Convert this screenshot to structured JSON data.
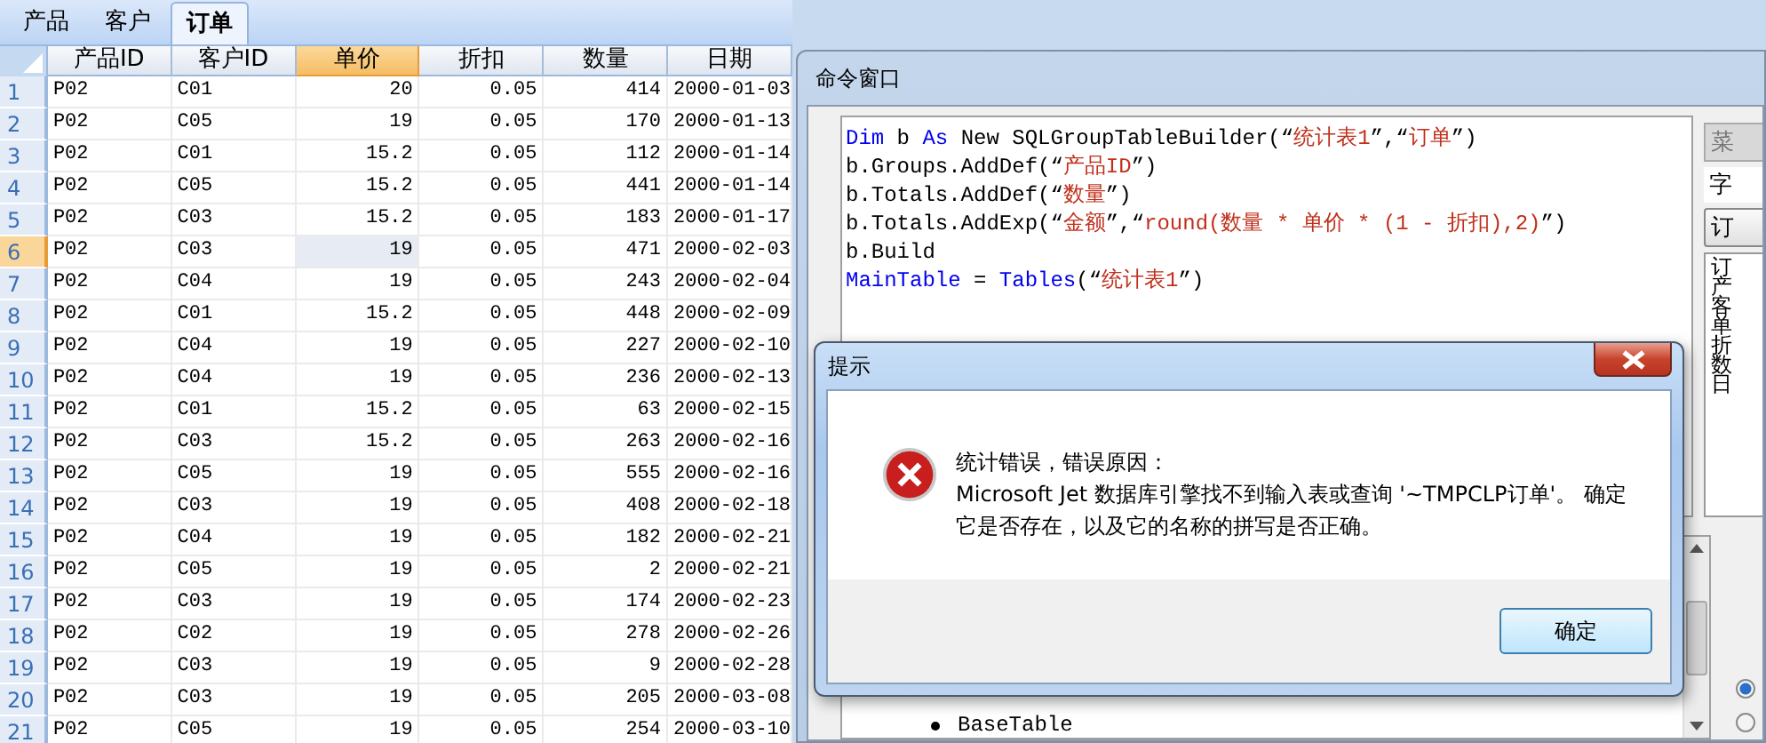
{
  "tabs": [
    {
      "label": "产品",
      "selected": false
    },
    {
      "label": "客户",
      "selected": false
    },
    {
      "label": "订单",
      "selected": true
    }
  ],
  "table": {
    "columns": [
      {
        "label": "产品ID",
        "kind": "text",
        "selected": false
      },
      {
        "label": "客户ID",
        "kind": "text",
        "selected": false
      },
      {
        "label": "单价",
        "kind": "number",
        "selected": true
      },
      {
        "label": "折扣",
        "kind": "number",
        "selected": false
      },
      {
        "label": "数量",
        "kind": "number",
        "selected": false
      },
      {
        "label": "日期",
        "kind": "text",
        "selected": false
      }
    ],
    "rows": [
      {
        "number": "1",
        "selected": false,
        "cells": [
          "P02",
          "C01",
          "20",
          "0.05",
          "414",
          "2000-01-03"
        ]
      },
      {
        "number": "2",
        "selected": false,
        "cells": [
          "P02",
          "C05",
          "19",
          "0.05",
          "170",
          "2000-01-13"
        ]
      },
      {
        "number": "3",
        "selected": false,
        "cells": [
          "P02",
          "C01",
          "15.2",
          "0.05",
          "112",
          "2000-01-14"
        ]
      },
      {
        "number": "4",
        "selected": false,
        "cells": [
          "P02",
          "C05",
          "15.2",
          "0.05",
          "441",
          "2000-01-14"
        ]
      },
      {
        "number": "5",
        "selected": false,
        "cells": [
          "P02",
          "C03",
          "15.2",
          "0.05",
          "183",
          "2000-01-17"
        ]
      },
      {
        "number": "6",
        "selected": true,
        "cells": [
          "P02",
          "C03",
          "19",
          "0.05",
          "471",
          "2000-02-03"
        ]
      },
      {
        "number": "7",
        "selected": false,
        "cells": [
          "P02",
          "C04",
          "19",
          "0.05",
          "243",
          "2000-02-04"
        ]
      },
      {
        "number": "8",
        "selected": false,
        "cells": [
          "P02",
          "C01",
          "15.2",
          "0.05",
          "448",
          "2000-02-09"
        ]
      },
      {
        "number": "9",
        "selected": false,
        "cells": [
          "P02",
          "C04",
          "19",
          "0.05",
          "227",
          "2000-02-10"
        ]
      },
      {
        "number": "10",
        "selected": false,
        "cells": [
          "P02",
          "C04",
          "19",
          "0.05",
          "236",
          "2000-02-13"
        ]
      },
      {
        "number": "11",
        "selected": false,
        "cells": [
          "P02",
          "C01",
          "15.2",
          "0.05",
          "63",
          "2000-02-15"
        ]
      },
      {
        "number": "12",
        "selected": false,
        "cells": [
          "P02",
          "C03",
          "15.2",
          "0.05",
          "263",
          "2000-02-16"
        ]
      },
      {
        "number": "13",
        "selected": false,
        "cells": [
          "P02",
          "C05",
          "19",
          "0.05",
          "555",
          "2000-02-16"
        ]
      },
      {
        "number": "14",
        "selected": false,
        "cells": [
          "P02",
          "C03",
          "19",
          "0.05",
          "408",
          "2000-02-18"
        ]
      },
      {
        "number": "15",
        "selected": false,
        "cells": [
          "P02",
          "C04",
          "19",
          "0.05",
          "182",
          "2000-02-21"
        ]
      },
      {
        "number": "16",
        "selected": false,
        "cells": [
          "P02",
          "C05",
          "19",
          "0.05",
          "2",
          "2000-02-21"
        ]
      },
      {
        "number": "17",
        "selected": false,
        "cells": [
          "P02",
          "C03",
          "19",
          "0.05",
          "174",
          "2000-02-23"
        ]
      },
      {
        "number": "18",
        "selected": false,
        "cells": [
          "P02",
          "C02",
          "19",
          "0.05",
          "278",
          "2000-02-26"
        ]
      },
      {
        "number": "19",
        "selected": false,
        "cells": [
          "P02",
          "C03",
          "19",
          "0.05",
          "9",
          "2000-02-28"
        ]
      },
      {
        "number": "20",
        "selected": false,
        "cells": [
          "P02",
          "C03",
          "19",
          "0.05",
          "205",
          "2000-03-08"
        ]
      },
      {
        "number": "21",
        "selected": false,
        "cells": [
          "P02",
          "C05",
          "19",
          "0.05",
          "254",
          "2000-03-10"
        ]
      }
    ]
  },
  "command_window": {
    "title": "命令窗口",
    "code_lines": [
      [
        {
          "kind": "keyword",
          "text": "Dim"
        },
        {
          "kind": "plain",
          "text": " b "
        },
        {
          "kind": "keyword",
          "text": "As"
        },
        {
          "kind": "plain",
          "text": " New SQLGroupTableBuilder(“"
        },
        {
          "kind": "string",
          "text": "统计表1"
        },
        {
          "kind": "plain",
          "text": "”,“"
        },
        {
          "kind": "string",
          "text": "订单"
        },
        {
          "kind": "plain",
          "text": "”)"
        }
      ],
      [
        {
          "kind": "plain",
          "text": "b.Groups.AddDef(“"
        },
        {
          "kind": "string",
          "text": "产品ID"
        },
        {
          "kind": "plain",
          "text": "”)"
        }
      ],
      [
        {
          "kind": "plain",
          "text": "b.Totals.AddDef(“"
        },
        {
          "kind": "string",
          "text": "数量"
        },
        {
          "kind": "plain",
          "text": "”)"
        }
      ],
      [
        {
          "kind": "plain",
          "text": "b.Totals.AddExp(“"
        },
        {
          "kind": "string",
          "text": "金额"
        },
        {
          "kind": "plain",
          "text": "”,“"
        },
        {
          "kind": "string",
          "text": "round(数量 * 单价 * (1 - 折扣),2)"
        },
        {
          "kind": "plain",
          "text": "”)"
        }
      ],
      [
        {
          "kind": "plain",
          "text": "b.Build"
        }
      ],
      [
        {
          "kind": "keyword",
          "text": "MainTable"
        },
        {
          "kind": "plain",
          "text": " = "
        },
        {
          "kind": "keyword",
          "text": "Tables"
        },
        {
          "kind": "plain",
          "text": "(“"
        },
        {
          "kind": "string",
          "text": "统计表1"
        },
        {
          "kind": "plain",
          "text": "”)"
        }
      ]
    ],
    "side_tab": "菜",
    "side_field": "字",
    "side_button": "订",
    "side_list": [
      "订",
      "产",
      "客",
      "单",
      "折",
      "数",
      "日"
    ],
    "help_items": [
      "BaseTable"
    ],
    "radios": [
      {
        "selected": true
      },
      {
        "selected": false
      }
    ]
  },
  "dialog": {
    "title": "提示",
    "message_lines": [
      "统计错误，错误原因：",
      "Microsoft Jet 数据库引擎找不到输入表或查询 '~TMPCLP订单'。 确定",
      "它是否存在，以及它的名称的拼写是否正确。"
    ],
    "button": "确定"
  }
}
